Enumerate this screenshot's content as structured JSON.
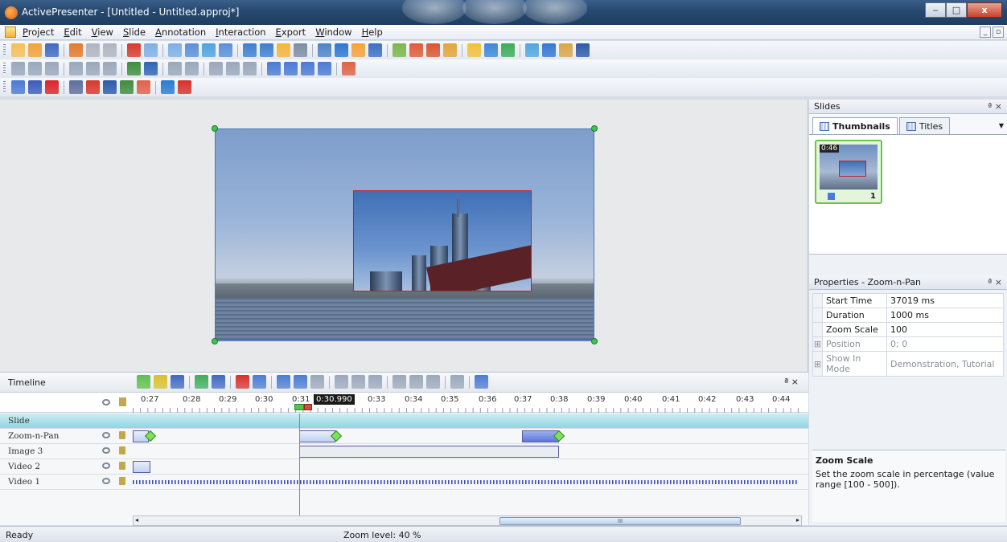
{
  "window": {
    "title": "ActivePresenter - [Untitled - Untitled.approj*]",
    "buttons": {
      "minimize": "‒",
      "maximize": "□",
      "close": "x"
    }
  },
  "menu": {
    "items": [
      "Project",
      "Edit",
      "View",
      "Slide",
      "Annotation",
      "Interaction",
      "Export",
      "Window",
      "Help"
    ]
  },
  "toolbar_colors": {
    "t1": [
      "#f4c15a",
      "#f1a33a",
      "#3f6ac2",
      "#e47a2b",
      "#b0b6c0",
      "#b0b6c0",
      "#d83a2c",
      "#7eb0e6",
      "#7eb0e6",
      "#5c8fd8",
      "#4fa3e0",
      "#5c8fd8",
      "#3f7fd0",
      "#3f7fd0",
      "#f4b63a",
      "#7e8da3",
      "#4d83c9",
      "#2c77d3",
      "#f6a13b",
      "#3d6fc4",
      "#7cb64a",
      "#e05b3a",
      "#d8562f",
      "#e2a63a",
      "#f0c13a",
      "#3e88d8",
      "#3cae58",
      "#51a8de",
      "#3577d3",
      "#d8a64a",
      "#2d5aa8"
    ],
    "t2": [
      "#9aa8bb",
      "#9aa8bb",
      "#9aa8bb",
      "#9aa8bb",
      "#9aa8bb",
      "#9aa8bb",
      "#3f8d3f",
      "#2f64b8",
      "#9aa8bb",
      "#9aa8bb",
      "#9aa8bb",
      "#9aa8bb",
      "#9aa8bb",
      "#4b7bd4",
      "#4b7bd4",
      "#4b7bd4",
      "#4b7bd4",
      "#e0624a"
    ],
    "t3": [
      "#4b7bd4",
      "#3c5cb8",
      "#d8262c",
      "#5d6f9c",
      "#d6382b",
      "#2d5aa8",
      "#3f8d3f",
      "#e0624a",
      "#2b7bd3",
      "#d8302c"
    ]
  },
  "slides_pane": {
    "title": "Slides",
    "pin": "ª ×",
    "tabs": [
      {
        "label": "Thumbnails",
        "active": true
      },
      {
        "label": "Titles",
        "active": false
      }
    ],
    "tab_menu": "▼",
    "thumbnail": {
      "duration": "0:46",
      "number": "1"
    }
  },
  "properties_pane": {
    "title": "Properties - Zoom-n-Pan",
    "pin": "ª ×",
    "rows": [
      {
        "expand": "",
        "key": "Start Time",
        "value": "37019 ms",
        "dim": false
      },
      {
        "expand": "",
        "key": "Duration",
        "value": "1000 ms",
        "dim": false
      },
      {
        "expand": "",
        "key": "Zoom Scale",
        "value": "100",
        "dim": false
      },
      {
        "expand": "⊞",
        "key": "Position",
        "value": "0; 0",
        "dim": true
      },
      {
        "expand": "⊞",
        "key": "Show In Mode",
        "value": "Demonstration, Tutorial",
        "dim": true
      }
    ],
    "help": {
      "title": "Zoom Scale",
      "text": "Set the zoom scale in percentage (value range [100 - 500])."
    }
  },
  "timeline": {
    "title": "Timeline",
    "pin": "ª ×",
    "tool_colors": [
      "#5cbf4a",
      "#d8c12a",
      "#3f6ac2",
      "#3cae58",
      "#3f6ac2",
      "#d8302c",
      "#4b7bd4",
      "#4b7bd4",
      "#4b7bd4",
      "#9aa8bb",
      "#9aa8bb",
      "#9aa8bb",
      "#9aa8bb",
      "#9aa8bb",
      "#9aa8bb",
      "#9aa8bb",
      "#9aa8bb",
      "#4b7bd4"
    ],
    "ticks": [
      "0:27",
      "0:28",
      "0:29",
      "0:30",
      "0:31",
      "0:33",
      "0:34",
      "0:35",
      "0:36",
      "0:37",
      "0:38",
      "0:39",
      "0:40",
      "0:41",
      "0:42",
      "0:43",
      "0:44"
    ],
    "playhead_time": "0:30.990",
    "tracks": [
      {
        "name": "Slide",
        "kind": "slide"
      },
      {
        "name": "Zoom-n-Pan",
        "kind": "zoom"
      },
      {
        "name": "Image 3",
        "kind": "image"
      },
      {
        "name": "Video 2",
        "kind": "video2"
      },
      {
        "name": "Video 1",
        "kind": "video1"
      }
    ],
    "scroll_thumb": "III"
  },
  "status": {
    "left": "Ready",
    "zoom": "Zoom level: 40 %"
  }
}
